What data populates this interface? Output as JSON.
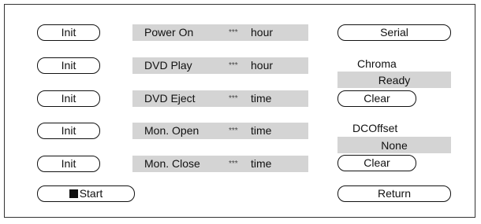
{
  "left_buttons": [
    {
      "label": "Init"
    },
    {
      "label": "Init"
    },
    {
      "label": "Init"
    },
    {
      "label": "Init"
    },
    {
      "label": "Init"
    }
  ],
  "counters": [
    {
      "name": "Power On",
      "value": "***",
      "unit": "hour"
    },
    {
      "name": "DVD Play",
      "value": "***",
      "unit": "hour"
    },
    {
      "name": "DVD Eject",
      "value": "***",
      "unit": "time"
    },
    {
      "name": "Mon. Open",
      "value": "***",
      "unit": "time"
    },
    {
      "name": "Mon. Close",
      "value": "***",
      "unit": "time"
    }
  ],
  "start_button": {
    "label": "Start",
    "icon": "square-icon"
  },
  "serial_button": {
    "label": "Serial"
  },
  "chroma": {
    "label": "Chroma",
    "status": "Ready",
    "clear_label": "Clear"
  },
  "dcoffset": {
    "label": "DCOffset",
    "status": "None",
    "clear_label": "Clear"
  },
  "return_button": {
    "label": "Return"
  }
}
